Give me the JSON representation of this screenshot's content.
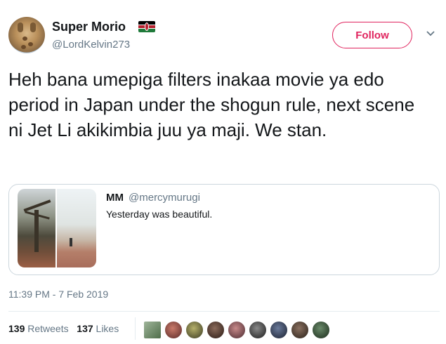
{
  "author": {
    "name": "Super Morio",
    "handle": "@LordKelvin273",
    "flag_icon": "kenya-flag-icon",
    "follow_label": "Follow"
  },
  "tweet": {
    "text": "Heh bana umepiga filters inakaa movie ya edo period in Japan under the shogun rule, next scene ni Jet Li akikimbia juu ya maji. We stan."
  },
  "quoted": {
    "name": "MM",
    "handle": "@mercymurugi",
    "text": "Yesterday was beautiful."
  },
  "timestamp": "11:39 PM - 7 Feb 2019",
  "stats": {
    "retweets_count": "139",
    "retweets_label": "Retweets",
    "likes_count": "137",
    "likes_label": "Likes"
  },
  "colors": {
    "follow_accent": "#e0245e",
    "secondary_text": "#657786",
    "border": "#ccd6dd"
  }
}
